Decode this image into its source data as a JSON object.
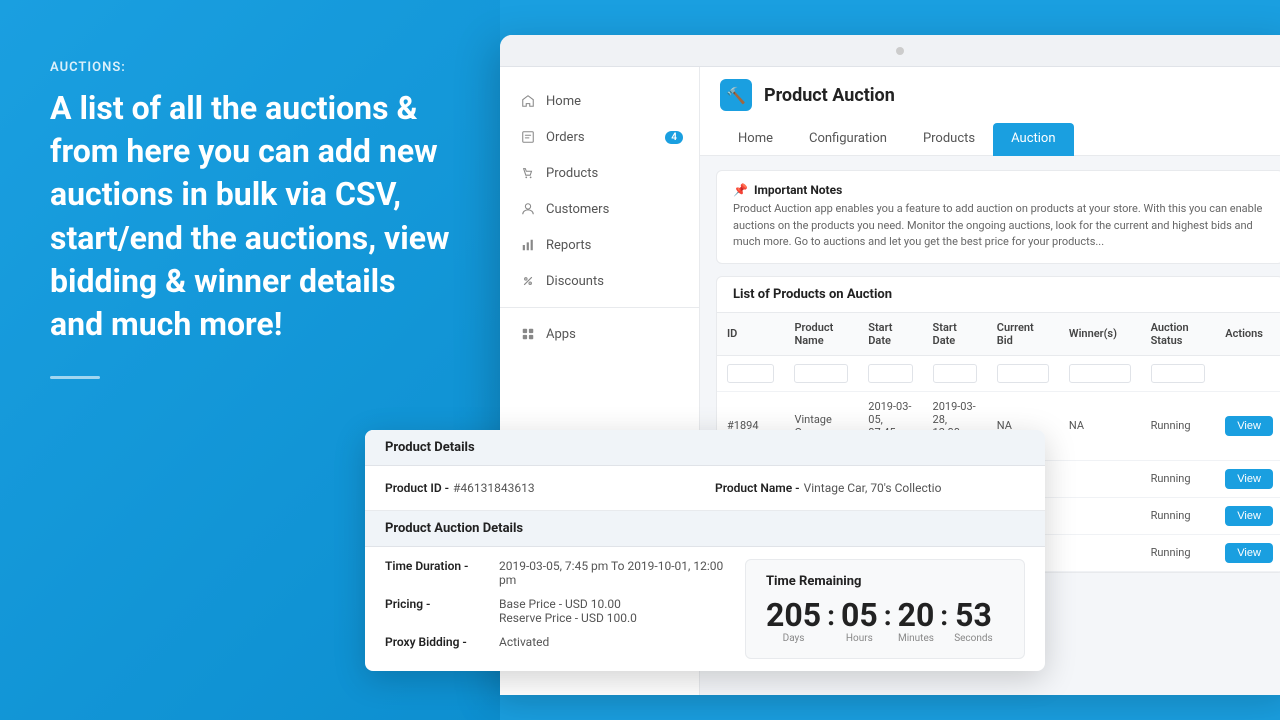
{
  "left": {
    "label": "AUCTIONS:",
    "heading": "A list of all the auctions & from here you can add new auctions in bulk via CSV, start/end the auctions, view bidding & winner details and much more!"
  },
  "app": {
    "title": "Product Auction",
    "window_dot_color": "#ccc"
  },
  "sidebar": {
    "items": [
      {
        "id": "home",
        "label": "Home",
        "icon": "home-icon",
        "badge": null
      },
      {
        "id": "orders",
        "label": "Orders",
        "icon": "orders-icon",
        "badge": "4"
      },
      {
        "id": "products",
        "label": "Products",
        "icon": "products-icon",
        "badge": null
      },
      {
        "id": "customers",
        "label": "Customers",
        "icon": "customers-icon",
        "badge": null
      },
      {
        "id": "reports",
        "label": "Reports",
        "icon": "reports-icon",
        "badge": null
      },
      {
        "id": "discounts",
        "label": "Discounts",
        "icon": "discounts-icon",
        "badge": null
      },
      {
        "id": "apps",
        "label": "Apps",
        "icon": "apps-icon",
        "badge": null
      }
    ]
  },
  "nav_tabs": [
    {
      "id": "home",
      "label": "Home",
      "active": false
    },
    {
      "id": "configuration",
      "label": "Configuration",
      "active": false
    },
    {
      "id": "products",
      "label": "Products",
      "active": false
    },
    {
      "id": "auction",
      "label": "Auction",
      "active": true
    }
  ],
  "notes": {
    "title": "Important Notes",
    "text": "Product Auction app enables you a feature to add auction on products at your store. With this you can enable auctions on the products you need. Monitor the ongoing auctions, look for the current and highest bids and much more. Go to auctions and let you get the best price for your products..."
  },
  "table": {
    "title": "List of Products on Auction",
    "columns": [
      "ID",
      "Product Name",
      "Start Date",
      "Start Date",
      "Current Bid",
      "Winner(s)",
      "Auction Status",
      "Actions"
    ],
    "rows": [
      {
        "id": "#1894",
        "product_name": "Vintage Car ...",
        "start_date": "2019-03-05, 07:45 pm",
        "end_date": "2019-03-28, 12:00 pm",
        "current_bid": "NA",
        "winners": "NA",
        "status": "Running",
        "action": "View"
      },
      {
        "id": "",
        "product_name": "",
        "start_date": "",
        "end_date": "",
        "current_bid": "",
        "winners": "",
        "status": "Running",
        "action": "View"
      },
      {
        "id": "",
        "product_name": "",
        "start_date": "",
        "end_date": "",
        "current_bid": "",
        "winners": "",
        "status": "Running",
        "action": "View"
      },
      {
        "id": "",
        "product_name": "",
        "start_date": "",
        "end_date": "",
        "current_bid": "",
        "winners": "",
        "status": "Running",
        "action": "View"
      }
    ]
  },
  "product_details": {
    "section_header": "Product Details",
    "product_id_label": "Product ID -",
    "product_id_value": "#46131843613",
    "product_name_label": "Product Name -",
    "product_name_value": "Vintage Car, 70's Collectio",
    "auction_section_header": "Product Auction Details",
    "time_duration_label": "Time Duration -",
    "time_duration_value": "2019-03-05, 7:45 pm To 2019-10-01, 12:00 pm",
    "pricing_label": "Pricing -",
    "pricing_base": "Base Price - USD 10.00",
    "pricing_reserve": "Reserve Price - USD 100.0",
    "proxy_bidding_label": "Proxy Bidding -",
    "proxy_bidding_value": "Activated",
    "countdown": {
      "title": "Time Remaining",
      "days": "205",
      "hours": "05",
      "minutes": "20",
      "seconds": "53",
      "days_label": "Days",
      "hours_label": "Hours",
      "minutes_label": "Minutes",
      "seconds_label": "Seconds"
    }
  },
  "colors": {
    "accent": "#1a9fe0",
    "bg_blue": "#1a9fe0"
  }
}
